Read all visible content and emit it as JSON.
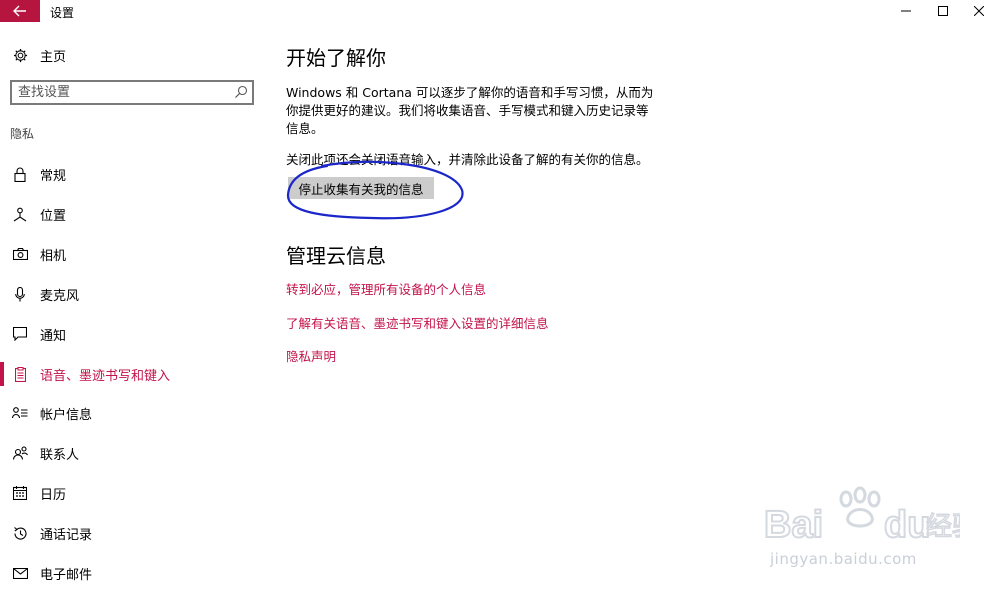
{
  "window": {
    "title": "设置",
    "accent_color": "#b5153f"
  },
  "sidebar": {
    "home_label": "主页",
    "search_placeholder": "查找设置",
    "section_label": "隐私",
    "items": [
      {
        "label": "常规",
        "icon": "lock-icon"
      },
      {
        "label": "位置",
        "icon": "location-icon"
      },
      {
        "label": "相机",
        "icon": "camera-icon"
      },
      {
        "label": "麦克风",
        "icon": "microphone-icon"
      },
      {
        "label": "通知",
        "icon": "notification-icon"
      },
      {
        "label": "语音、墨迹书写和键入",
        "icon": "clipboard-icon",
        "active": true
      },
      {
        "label": "帐户信息",
        "icon": "account-info-icon"
      },
      {
        "label": "联系人",
        "icon": "contacts-icon"
      },
      {
        "label": "日历",
        "icon": "calendar-icon"
      },
      {
        "label": "通话记录",
        "icon": "call-history-icon"
      },
      {
        "label": "电子邮件",
        "icon": "email-icon"
      }
    ]
  },
  "main": {
    "title": "开始了解你",
    "description": "Windows 和 Cortana 可以逐步了解你的语音和手写习惯，从而为你提供更好的建议。我们将收集语音、手写模式和键入历史记录等信息。",
    "off_note": "关闭此项还会关闭语音输入，并清除此设备了解的有关你的信息。",
    "stop_button": "停止收集有关我的信息",
    "cloud_title": "管理云信息",
    "links": [
      "转到必应，管理所有设备的个人信息",
      "了解有关语音、墨迹书写和键入设置的详细信息",
      "隐私声明"
    ],
    "link_color": "#c3134b"
  },
  "watermark": {
    "url": "jingyan.baidu.com"
  }
}
